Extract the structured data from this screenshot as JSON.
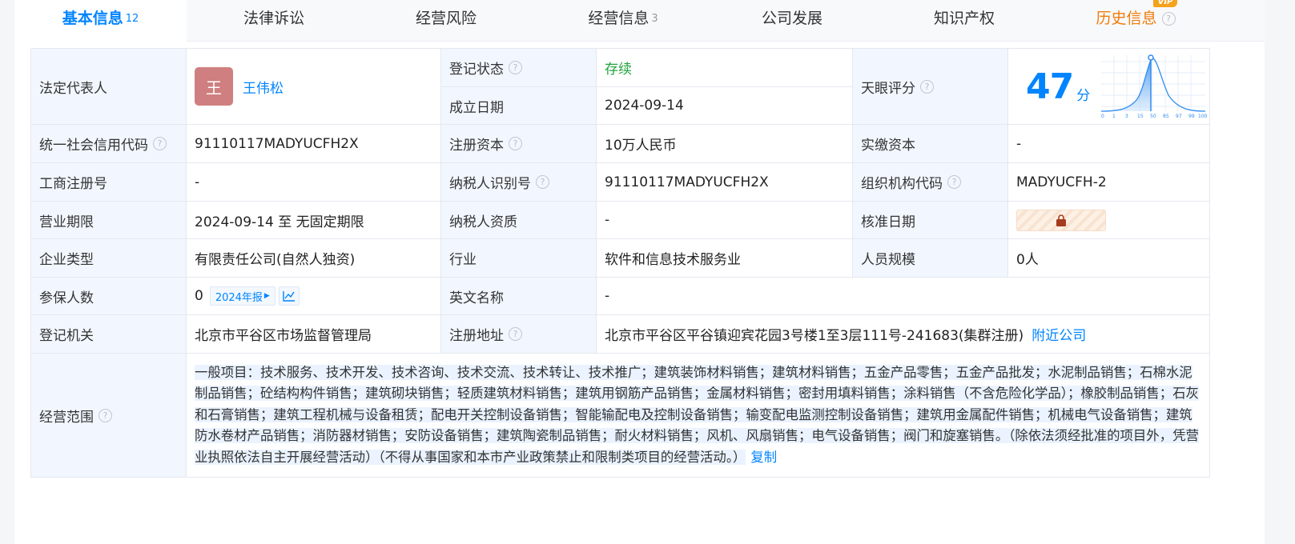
{
  "tabs": [
    {
      "label": "基本信息",
      "count": "12",
      "active": true
    },
    {
      "label": "法律诉讼",
      "count": ""
    },
    {
      "label": "经营风险",
      "count": ""
    },
    {
      "label": "经营信息",
      "count": "3"
    },
    {
      "label": "公司发展",
      "count": ""
    },
    {
      "label": "知识产权",
      "count": ""
    },
    {
      "label": "历史信息",
      "count": "",
      "vip_badge": "VIP"
    }
  ],
  "info": {
    "legal_rep_label": "法定代表人",
    "legal_rep_avatar": "王",
    "legal_rep_name": "王伟松",
    "reg_status_label": "登记状态",
    "reg_status_value": "存续",
    "founded_label": "成立日期",
    "founded_value": "2024-09-14",
    "tianyan_label": "天眼评分",
    "score": "47",
    "score_unit": "分",
    "score_axis": [
      "0",
      "1",
      "3",
      "15",
      "50",
      "85",
      "97",
      "99",
      "100"
    ],
    "credit_code_label": "统一社会信用代码",
    "credit_code_value": "91110117MADYUCFH2X",
    "reg_capital_label": "注册资本",
    "reg_capital_value": "10万人民币",
    "paid_capital_label": "实缴资本",
    "paid_capital_value": "-",
    "biz_reg_no_label": "工商注册号",
    "biz_reg_no_value": "-",
    "taxpayer_id_label": "纳税人识别号",
    "taxpayer_id_value": "91110117MADYUCFH2X",
    "org_code_label": "组织机构代码",
    "org_code_value": "MADYUCFH-2",
    "term_label": "营业期限",
    "term_value": "2024-09-14 至 无固定期限",
    "taxpayer_qual_label": "纳税人资质",
    "taxpayer_qual_value": "-",
    "approval_date_label": "核准日期",
    "company_type_label": "企业类型",
    "company_type_value": "有限责任公司(自然人独资)",
    "industry_label": "行业",
    "industry_value": "软件和信息技术服务业",
    "staff_label": "人员规模",
    "staff_value": "0人",
    "insured_label": "参保人数",
    "insured_value": "0",
    "insured_report_tag": "2024年报",
    "english_name_label": "英文名称",
    "english_name_value": "-",
    "authority_label": "登记机关",
    "authority_value": "北京市平谷区市场监督管理局",
    "address_label": "注册地址",
    "address_value": "北京市平谷区平谷镇迎宾花园3号楼1至3层111号-241683(集群注册)",
    "nearby_link": "附近公司",
    "scope_label": "经营范围",
    "scope_value": "一般项目：技术服务、技术开发、技术咨询、技术交流、技术转让、技术推广；建筑装饰材料销售；建筑材料销售；五金产品零售；五金产品批发；水泥制品销售；石棉水泥制品销售；砼结构构件销售；建筑砌块销售；轻质建筑材料销售；建筑用钢筋产品销售；金属材料销售；密封用填料销售；涂料销售（不含危险化学品）；橡胶制品销售；石灰和石膏销售；建筑工程机械与设备租赁；配电开关控制设备销售；智能输配电及控制设备销售；输变配电监测控制设备销售；建筑用金属配件销售；机械电气设备销售；建筑防水卷材产品销售；消防器材销售；安防设备销售；建筑陶瓷制品销售；耐火材料销售；风机、风扇销售；电气设备销售；阀门和旋塞销售。（除依法须经批准的项目外，凭营业执照依法自主开展经营活动）（不得从事国家和本市产业政策禁止和限制类项目的经营活动。）",
    "copy_link": "复制"
  },
  "colors": {
    "accent": "#0084ff",
    "history_tab": "#f07c0c",
    "status_green": "#23a33f",
    "label_bg": "#f2f7ff"
  }
}
